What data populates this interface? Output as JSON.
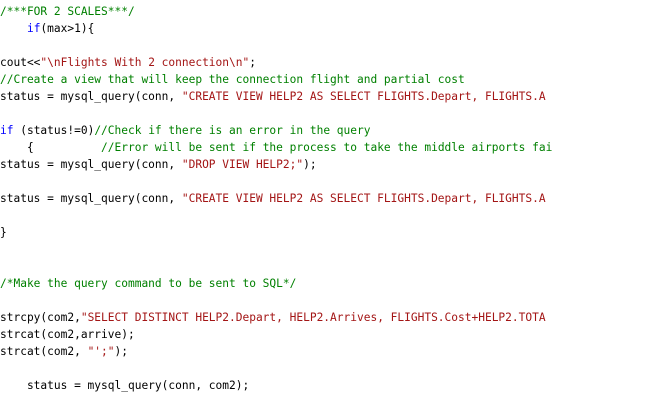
{
  "colors": {
    "comment": "#008000",
    "keyword": "#0000ff",
    "string": "#a31515",
    "default": "#000000",
    "background": "#ffffff"
  },
  "lines": [
    [
      {
        "t": "/***FOR 2 SCALES***/",
        "k": "c"
      }
    ],
    [
      {
        "t": "    ",
        "k": "n"
      },
      {
        "t": "if",
        "k": "k"
      },
      {
        "t": "(max>1){",
        "k": "n"
      }
    ],
    [],
    [
      {
        "t": "cout<<",
        "k": "n"
      },
      {
        "t": "\"\\nFlights With 2 connection\\n\"",
        "k": "s"
      },
      {
        "t": ";",
        "k": "n"
      }
    ],
    [
      {
        "t": "//Create a view that will keep the connection flight and partial cost",
        "k": "c"
      }
    ],
    [
      {
        "t": "status = mysql_query(conn, ",
        "k": "n"
      },
      {
        "t": "\"CREATE VIEW HELP2 AS SELECT FLIGHTS.Depart, FLIGHTS.A",
        "k": "s"
      }
    ],
    [],
    [
      {
        "t": "if",
        "k": "k"
      },
      {
        "t": " (status!=0)",
        "k": "n"
      },
      {
        "t": "//Check if there is an error in the query",
        "k": "c"
      }
    ],
    [
      {
        "t": "    {          ",
        "k": "n"
      },
      {
        "t": "//Error will be sent if the process to take the middle airports fai",
        "k": "c"
      }
    ],
    [
      {
        "t": "status = mysql_query(conn, ",
        "k": "n"
      },
      {
        "t": "\"DROP VIEW HELP2;\"",
        "k": "s"
      },
      {
        "t": ");",
        "k": "n"
      }
    ],
    [],
    [
      {
        "t": "status = mysql_query(conn, ",
        "k": "n"
      },
      {
        "t": "\"CREATE VIEW HELP2 AS SELECT FLIGHTS.Depart, FLIGHTS.A",
        "k": "s"
      }
    ],
    [],
    [
      {
        "t": "}",
        "k": "n"
      }
    ],
    [],
    [],
    [
      {
        "t": "/*Make the query command to be sent to SQL*/",
        "k": "c"
      }
    ],
    [],
    [
      {
        "t": "strcpy(com2,",
        "k": "n"
      },
      {
        "t": "\"SELECT DISTINCT HELP2.Depart, HELP2.Arrives, FLIGHTS.Cost+HELP2.TOTA",
        "k": "s"
      }
    ],
    [
      {
        "t": "strcat(com2,arrive);",
        "k": "n"
      }
    ],
    [
      {
        "t": "strcat(com2, ",
        "k": "n"
      },
      {
        "t": "\"';\"",
        "k": "s"
      },
      {
        "t": ");",
        "k": "n"
      }
    ],
    [],
    [
      {
        "t": "    status = mysql_query(conn, com2);",
        "k": "n"
      }
    ]
  ]
}
